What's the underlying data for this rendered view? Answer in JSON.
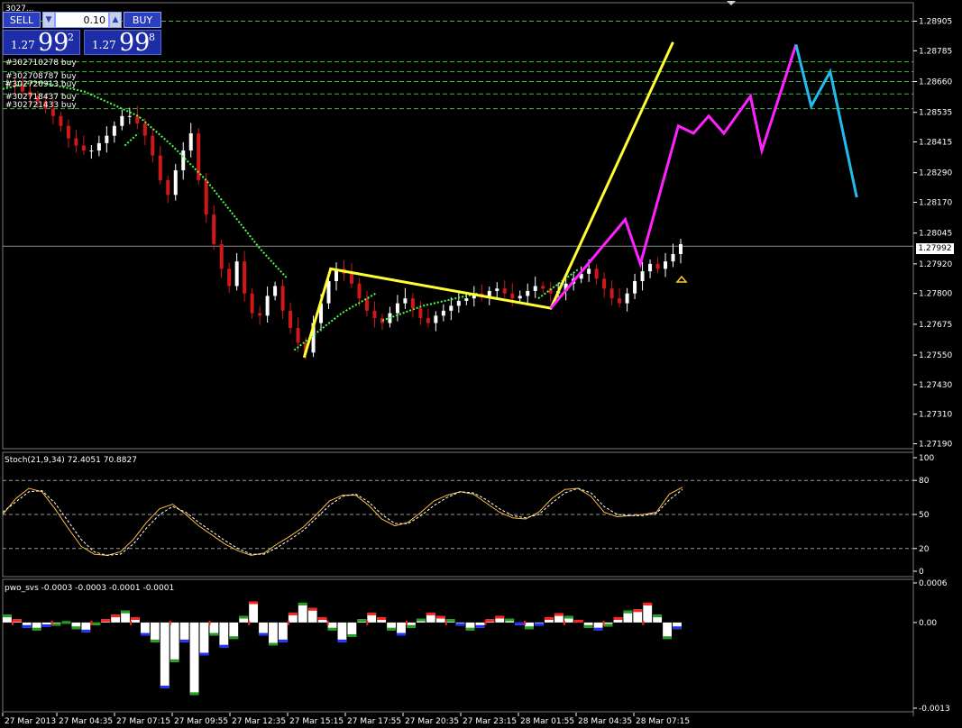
{
  "trade_panel": {
    "sell_label": "SELL",
    "buy_label": "BUY",
    "lot": "0.10",
    "sell_price": {
      "prefix": "1.27",
      "big": "99",
      "sup": "2"
    },
    "buy_price": {
      "prefix": "1.27",
      "big": "99",
      "sup": "8"
    }
  },
  "orders": [
    {
      "label": "#302710278 buy"
    },
    {
      "label": "#302708787 buy"
    },
    {
      "label": "#302726913 buy"
    },
    {
      "label": "#302718437 buy"
    },
    {
      "label": "#302721433 buy"
    }
  ],
  "colors": {
    "background": "#000000",
    "candle_bull": "#ffffff",
    "candle_bear": "#d01818",
    "grid_dash": "#3fbf3f",
    "ma_dots": "#4cff4c",
    "yellow_zigzag": "#ffff33",
    "magenta_path": "#ff22ff",
    "cyan_path": "#22bbee",
    "stoch_main": "#ffbf40",
    "stoch_signal": "#ffffff",
    "pwo_positive": "#ffffff",
    "pwo_red": "#ff2020",
    "pwo_green": "#1fa01f",
    "pwo_blue": "#2030ff"
  },
  "current_price": "1.27992",
  "chart_data": [
    {
      "type": "candlestick",
      "symbol_label": "3027...",
      "y_ticks": [
        "1.28905",
        "1.28785",
        "1.28660",
        "1.28535",
        "1.28415",
        "1.28290",
        "1.28170",
        "1.28045",
        "1.27920",
        "1.27800",
        "1.27675",
        "1.27550",
        "1.27430",
        "1.27310",
        "1.27190"
      ],
      "ylim": [
        1.2717,
        1.2898
      ],
      "x_ticks": [
        "27 Mar 2013",
        "27 Mar 04:35",
        "27 Mar 07:15",
        "27 Mar 09:55",
        "27 Mar 12:35",
        "27 Mar 15:15",
        "27 Mar 17:55",
        "27 Mar 20:35",
        "27 Mar 23:15",
        "28 Mar 01:55",
        "28 Mar 04:35",
        "28 Mar 07:15"
      ],
      "order_levels": [
        1.28905,
        1.2874,
        1.287,
        1.2866,
        1.2861,
        1.2855
      ],
      "close_series": [
        1.2865,
        1.2864,
        1.2862,
        1.286,
        1.2858,
        1.2855,
        1.2852,
        1.2848,
        1.2843,
        1.284,
        1.2838,
        1.2838,
        1.2841,
        1.2844,
        1.2848,
        1.2852,
        1.2852,
        1.2849,
        1.2844,
        1.2836,
        1.2826,
        1.282,
        1.283,
        1.2838,
        1.2845,
        1.2826,
        1.2812,
        1.28,
        1.279,
        1.2783,
        1.2793,
        1.278,
        1.2772,
        1.2771,
        1.2779,
        1.2783,
        1.2773,
        1.2766,
        1.276,
        1.2756,
        1.2768,
        1.2776,
        1.2785,
        1.279,
        1.2788,
        1.2784,
        1.2778,
        1.2773,
        1.277,
        1.2768,
        1.2772,
        1.2776,
        1.2778,
        1.2774,
        1.277,
        1.2768,
        1.2771,
        1.2773,
        1.2775,
        1.2777,
        1.2778,
        1.278,
        1.2779,
        1.2781,
        1.2782,
        1.278,
        1.2778,
        1.2779,
        1.2781,
        1.2783,
        1.2782,
        1.278,
        1.2781,
        1.2784,
        1.2786,
        1.2788,
        1.279,
        1.2786,
        1.2782,
        1.2778,
        1.2776,
        1.278,
        1.2785,
        1.2789,
        1.2792,
        1.279,
        1.2793,
        1.2796,
        1.28
      ],
      "ma_segments": [
        {
          "name": "ma-slow",
          "points": [
            [
              1.2863,
              0
            ],
            [
              1.2866,
              0.05
            ],
            [
              1.2862,
              0.12
            ],
            [
              1.2852,
              0.2
            ],
            [
              1.284,
              0.25
            ],
            [
              1.2826,
              0.3
            ],
            [
              1.2812,
              0.34
            ],
            [
              1.2798,
              0.38
            ],
            [
              1.2786,
              0.42
            ]
          ]
        },
        {
          "name": "ma-fast-1",
          "points": [
            [
              1.284,
              0.18
            ],
            [
              1.2845,
              0.2
            ]
          ]
        },
        {
          "name": "ma-fast-2",
          "points": [
            [
              1.2757,
              0.43
            ],
            [
              1.2772,
              0.5
            ],
            [
              1.278,
              0.55
            ]
          ]
        },
        {
          "name": "ma-fast-3",
          "points": [
            [
              1.2769,
              0.56
            ],
            [
              1.2775,
              0.62
            ],
            [
              1.278,
              0.7
            ]
          ]
        },
        {
          "name": "ma-fast-4",
          "points": [
            [
              1.2778,
              0.79
            ],
            [
              1.279,
              0.85
            ]
          ]
        }
      ],
      "yellow_zigzag": [
        [
          0.397,
          1.2754
        ],
        [
          0.432,
          1.279
        ],
        [
          0.722,
          1.2774
        ],
        [
          0.883,
          1.2882
        ]
      ],
      "magenta_path": [
        [
          0.722,
          1.2774
        ],
        [
          0.82,
          1.281
        ],
        [
          0.84,
          1.2792
        ],
        [
          0.89,
          1.2848
        ],
        [
          0.91,
          1.2845
        ],
        [
          0.93,
          1.2852
        ],
        [
          0.95,
          1.2845
        ],
        [
          0.985,
          1.286
        ],
        [
          1.0,
          1.2838
        ],
        [
          1.045,
          1.2881
        ]
      ],
      "cyan_path": [
        [
          1.045,
          1.2881
        ],
        [
          1.065,
          1.2856
        ],
        [
          1.09,
          1.287
        ],
        [
          1.125,
          1.2819
        ]
      ]
    },
    {
      "type": "line",
      "title": "Stoch(21,9,34) 72.4051 70.8827",
      "y_ticks": [
        "100",
        "80",
        "50",
        "20",
        "0"
      ],
      "ylim": [
        0,
        100
      ],
      "levels": [
        80,
        50,
        20
      ],
      "series": [
        {
          "name": "main",
          "values": [
            50,
            64,
            73,
            70,
            55,
            38,
            22,
            15,
            14,
            17,
            28,
            43,
            55,
            59,
            50,
            40,
            32,
            24,
            18,
            14,
            16,
            24,
            31,
            39,
            50,
            62,
            67,
            67,
            58,
            46,
            40,
            43,
            52,
            62,
            67,
            70,
            68,
            60,
            52,
            47,
            46,
            52,
            64,
            72,
            73,
            66,
            52,
            48,
            49,
            50,
            52,
            68,
            74
          ]
        },
        {
          "name": "signal",
          "values": [
            52,
            61,
            70,
            71,
            60,
            44,
            28,
            17,
            14,
            15,
            24,
            38,
            50,
            57,
            52,
            43,
            35,
            27,
            20,
            15,
            15,
            21,
            28,
            36,
            47,
            58,
            66,
            68,
            61,
            50,
            42,
            42,
            49,
            58,
            65,
            70,
            69,
            63,
            55,
            49,
            47,
            50,
            60,
            69,
            73,
            69,
            57,
            50,
            49,
            49,
            51,
            63,
            72
          ]
        }
      ]
    },
    {
      "type": "bar",
      "title": "pwo_svs -0.0003 -0.0003 -0.0001 -0.0001",
      "y_ticks": [
        "0.0006",
        "0.00",
        "-0.0013"
      ],
      "ylim": [
        -0.0013,
        0.0006
      ],
      "values": [
        0.00012,
        5e-05,
        -8e-05,
        -0.00012,
        -7e-05,
        -5e-05,
        2e-05,
        -0.0001,
        -0.00015,
        -4e-05,
        5e-05,
        0.00012,
        0.00018,
        8e-05,
        -0.0002,
        -0.0003,
        -0.001,
        -0.0006,
        -0.0003,
        -0.0011,
        -0.0005,
        -0.0002,
        -0.00038,
        -0.00025,
        0.0001,
        0.00032,
        -0.0002,
        -0.00035,
        -0.0003,
        0.00015,
        0.0003,
        0.00022,
        8e-05,
        -0.00012,
        -0.0003,
        -0.00022,
        5e-05,
        0.00015,
        8e-05,
        -0.00012,
        -0.0002,
        -8e-05,
        6e-05,
        0.00015,
        0.0001,
        5e-05,
        -5e-05,
        -0.00012,
        -8e-05,
        5e-05,
        0.0001,
        6e-05,
        -4e-05,
        -0.0001,
        -5e-05,
        8e-05,
        0.00014,
        0.0001,
        4e-05,
        -8e-05,
        -0.00012,
        -6e-05,
        8e-05,
        0.00018,
        0.0002,
        0.0003,
        0.00012,
        -0.00025,
        -0.0001
      ]
    }
  ]
}
